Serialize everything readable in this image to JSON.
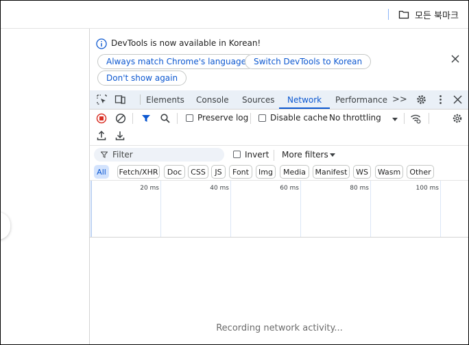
{
  "bookmarks": {
    "folder_label": "모든 북마크",
    "folder_icon": "folder-icon"
  },
  "infobar": {
    "message": "DevTools is now available in Korean!",
    "buttons": [
      "Always match Chrome's language",
      "Switch DevTools to Korean",
      "Don't show again"
    ],
    "close_icon": "close-icon"
  },
  "tabs": {
    "items": [
      "Elements",
      "Console",
      "Sources",
      "Network",
      "Performance"
    ],
    "active": "Network",
    "more": ">>"
  },
  "toolbar": {
    "preserve_log": "Preserve log",
    "disable_cache": "Disable cache",
    "throttling": "No throttling"
  },
  "filter": {
    "placeholder": "Filter",
    "invert": "Invert",
    "more_filters": "More filters"
  },
  "types": [
    "All",
    "Fetch/XHR",
    "Doc",
    "CSS",
    "JS",
    "Font",
    "Img",
    "Media",
    "Manifest",
    "WS",
    "Wasm",
    "Other"
  ],
  "timeline": {
    "ticks": [
      "20 ms",
      "40 ms",
      "60 ms",
      "80 ms",
      "100 ms"
    ]
  },
  "status": {
    "recording": "Recording network activity..."
  },
  "colors": {
    "accent": "#0b57d0",
    "record_red": "#d93025",
    "tabbar_bg": "#eaf0f7"
  }
}
